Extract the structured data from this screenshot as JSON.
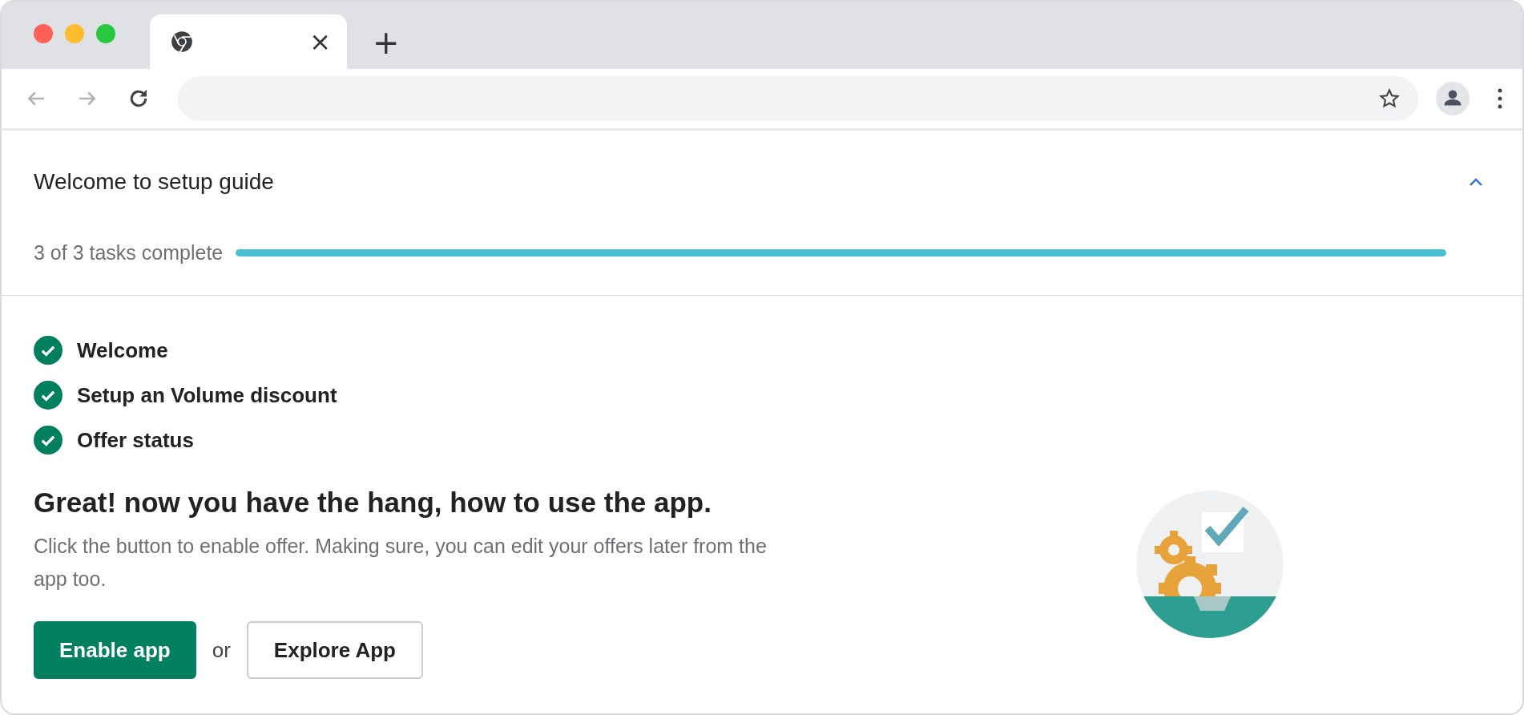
{
  "browser": {
    "tab": {
      "close": "×"
    },
    "new_tab": "+"
  },
  "setup_guide": {
    "title": "Welcome to setup guide",
    "expanded": true,
    "progress": {
      "label": "3 of 3 tasks complete",
      "level": 1
    },
    "tasks": [
      {
        "label": "Welcome",
        "checked": true
      },
      {
        "label": "Setup an Volume discount",
        "checked": true
      },
      {
        "label": "Offer status",
        "checked": true
      }
    ],
    "heading": "Great! now you have the hang, how to use the app.",
    "description": "Click the button to enable offer. Making sure, you can edit your offers later from the app too.",
    "primary_button": "Enable app",
    "separator": "or",
    "secondary_button": "Explore App"
  }
}
